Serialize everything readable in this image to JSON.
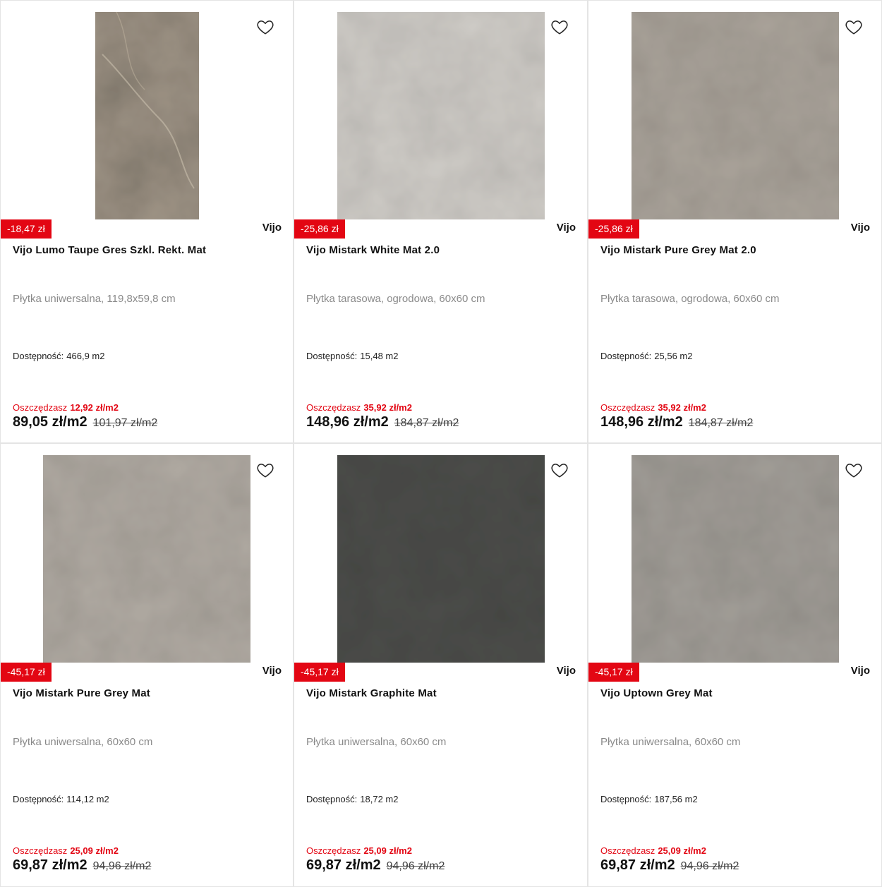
{
  "icons": {
    "favorite": "heart-outline-icon"
  },
  "colors": {
    "accent_red": "#e30613",
    "card_border": "#e4e4e4"
  },
  "products": [
    {
      "discount": "-18,47 zł",
      "brand": "Vijo",
      "title": "Vijo Lumo Taupe Gres Szkl. Rekt. Mat",
      "subtitle": "Płytka uniwersalna, 119,8x59,8 cm",
      "availability_label": "Dostępność:",
      "availability_value": "466,9 m2",
      "save_label": "Oszczędzasz",
      "save_value": "12,92 zł/m2",
      "price": "89,05 zł/m2",
      "old_price": "101,97 zł/m2"
    },
    {
      "discount": "-25,86 zł",
      "brand": "Vijo",
      "title": "Vijo Mistark White Mat 2.0",
      "subtitle": "Płytka tarasowa, ogrodowa, 60x60 cm",
      "availability_label": "Dostępność:",
      "availability_value": "15,48 m2",
      "save_label": "Oszczędzasz",
      "save_value": "35,92 zł/m2",
      "price": "148,96 zł/m2",
      "old_price": "184,87 zł/m2"
    },
    {
      "discount": "-25,86 zł",
      "brand": "Vijo",
      "title": "Vijo Mistark Pure Grey Mat 2.0",
      "subtitle": "Płytka tarasowa, ogrodowa, 60x60 cm",
      "availability_label": "Dostępność:",
      "availability_value": "25,56 m2",
      "save_label": "Oszczędzasz",
      "save_value": "35,92 zł/m2",
      "price": "148,96 zł/m2",
      "old_price": "184,87 zł/m2"
    },
    {
      "discount": "-45,17 zł",
      "brand": "Vijo",
      "title": "Vijo Mistark Pure Grey Mat",
      "subtitle": "Płytka uniwersalna, 60x60 cm",
      "availability_label": "Dostępność:",
      "availability_value": "114,12 m2",
      "save_label": "Oszczędzasz",
      "save_value": "25,09 zł/m2",
      "price": "69,87 zł/m2",
      "old_price": "94,96 zł/m2"
    },
    {
      "discount": "-45,17 zł",
      "brand": "Vijo",
      "title": "Vijo Mistark Graphite Mat",
      "subtitle": "Płytka uniwersalna, 60x60 cm",
      "availability_label": "Dostępność:",
      "availability_value": "18,72 m2",
      "save_label": "Oszczędzasz",
      "save_value": "25,09 zł/m2",
      "price": "69,87 zł/m2",
      "old_price": "94,96 zł/m2"
    },
    {
      "discount": "-45,17 zł",
      "brand": "Vijo",
      "title": "Vijo Uptown Grey Mat",
      "subtitle": "Płytka uniwersalna, 60x60 cm",
      "availability_label": "Dostępność:",
      "availability_value": "187,56 m2",
      "save_label": "Oszczędzasz",
      "save_value": "25,09 zł/m2",
      "price": "69,87 zł/m2",
      "old_price": "94,96 zł/m2"
    }
  ]
}
